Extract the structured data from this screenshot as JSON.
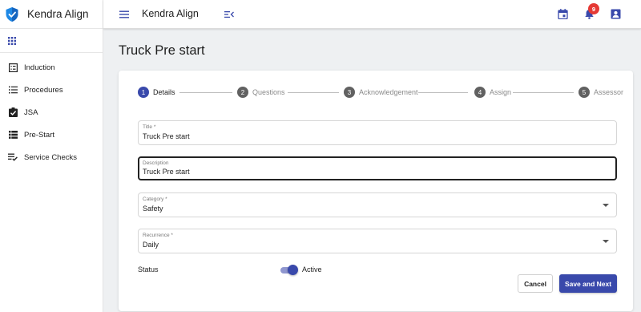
{
  "app": {
    "name": "Kendra Align"
  },
  "colors": {
    "primary": "#3949ab",
    "badge": "#e53935"
  },
  "sidebar": {
    "apps_icon": "grid-apps-icon",
    "items": [
      {
        "label": "Induction",
        "icon": "list-alt-icon"
      },
      {
        "label": "Procedures",
        "icon": "list-icon"
      },
      {
        "label": "JSA",
        "icon": "clipboard-check-icon"
      },
      {
        "label": "Pre-Start",
        "icon": "view-list-icon"
      },
      {
        "label": "Service Checks",
        "icon": "playlist-check-icon"
      }
    ]
  },
  "topbar": {
    "title": "Kendra Align",
    "notifications_count": "9",
    "icons": [
      "menu-icon",
      "menu-open-icon",
      "calendar-icon",
      "bell-icon",
      "account-box-icon"
    ]
  },
  "page": {
    "title": "Truck Pre start"
  },
  "stepper": {
    "steps": [
      {
        "num": "1",
        "label": "Details",
        "active": true
      },
      {
        "num": "2",
        "label": "Questions",
        "active": false
      },
      {
        "num": "3",
        "label": "Acknowledgement",
        "active": false
      },
      {
        "num": "4",
        "label": "Assign",
        "active": false
      },
      {
        "num": "5",
        "label": "Assessor",
        "active": false
      }
    ]
  },
  "form": {
    "title": {
      "label": "Title *",
      "value": "Truck Pre start"
    },
    "description": {
      "label": "Description",
      "value": "Truck Pre start"
    },
    "category": {
      "label": "Category *",
      "value": "Safety"
    },
    "recurrence": {
      "label": "Recurrence *",
      "value": "Daily"
    },
    "status": {
      "label": "Status",
      "toggle_label": "Active",
      "on": true
    }
  },
  "actions": {
    "cancel": "Cancel",
    "save_next": "Save and Next"
  }
}
